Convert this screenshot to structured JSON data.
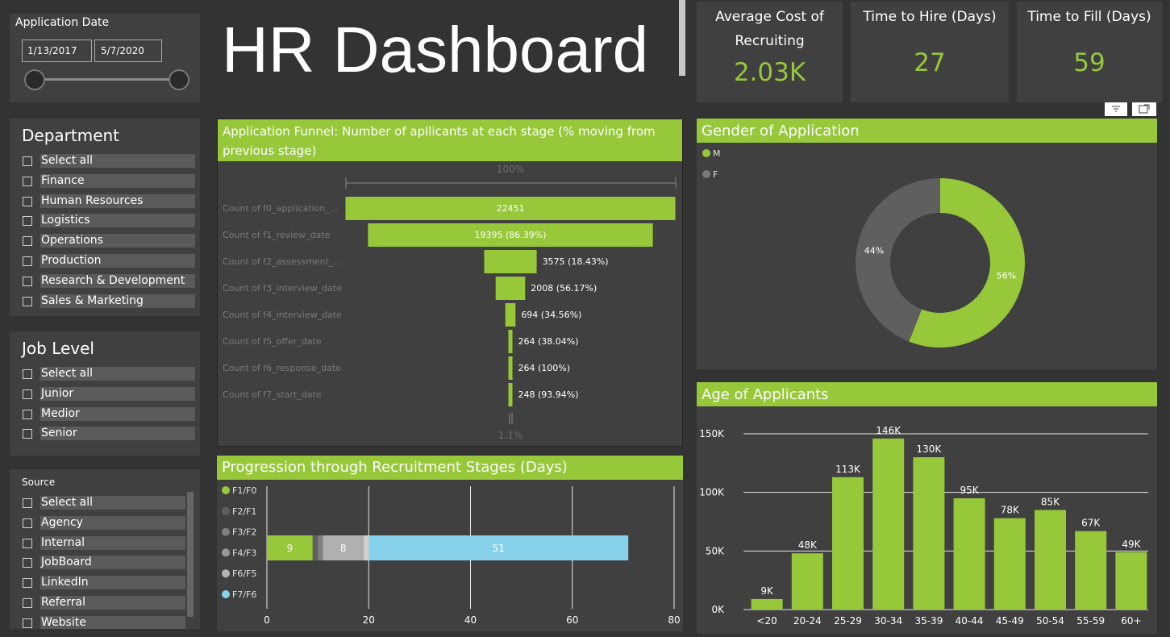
{
  "colors": {
    "accent": "#96c83a",
    "panel": "#404040",
    "bg": "#333333",
    "light_blue": "#87d1ea",
    "grey": "#7a7a7a",
    "light_grey": "#b4b4b4"
  },
  "title": "HR Dashboard",
  "date_slicer": {
    "label": "Application Date",
    "start": "1/13/2017",
    "end": "5/7/2020"
  },
  "department": {
    "title": "Department",
    "items": [
      "Select all",
      "Finance",
      "Human Resources",
      "Logistics",
      "Operations",
      "Production",
      "Research & Development",
      "Sales & Marketing"
    ]
  },
  "job_level": {
    "title": "Job Level",
    "items": [
      "Select all",
      "Junior",
      "Medior",
      "Senior"
    ]
  },
  "source": {
    "title": "Source",
    "items": [
      "Select all",
      "Agency",
      "Internal",
      "JobBoard",
      "LinkedIn",
      "Referral",
      "Website"
    ]
  },
  "kpis": [
    {
      "label": "Average Cost of Recruiting",
      "value": "2.03K"
    },
    {
      "label": "Time to Hire (Days)",
      "value": "27"
    },
    {
      "label": "Time to Fill (Days)",
      "value": "59"
    }
  ],
  "toolbar": {
    "filter_icon": "filter-icon",
    "focus_icon": "focus-mode-icon"
  },
  "funnel_title": "Application Funnel: Number of apllicants at each stage (% moving from previous stage)",
  "progression_title": "Progression through Recruitment Stages (Days)",
  "gender_title": "Gender of Application",
  "age_title": "Age of Applicants",
  "chart_data": [
    {
      "type": "bar",
      "subtype": "funnel",
      "top_label": "100%",
      "bottom_label": "1.1%",
      "categories": [
        "Count of f0_application_...",
        "Count of f1_review_date",
        "Count of f2_assessment_...",
        "Count of f3_interview_date",
        "Count of f4_interview_date",
        "Count of f5_offer_date",
        "Count of f6_response_date",
        "Count of f7_start_date"
      ],
      "values": [
        22451,
        19395,
        3575,
        2008,
        694,
        264,
        264,
        248
      ],
      "labels": [
        "22451",
        "19395 (86.39%)",
        "3575 (18.43%)",
        "2008 (56.17%)",
        "694 (34.56%)",
        "264 (38.04%)",
        "264 (100%)",
        "248 (93.94%)"
      ]
    },
    {
      "type": "bar",
      "subtype": "stacked-horizontal",
      "legend": [
        "F1/F0",
        "F2/F1",
        "F3/F2",
        "F4/F3",
        "F6/F5",
        "F7/F6"
      ],
      "legend_colors": [
        "#96c83a",
        "#606060",
        "#808080",
        "#9a9a9a",
        "#b4b4b4",
        "#87d1ea"
      ],
      "series": [
        {
          "name": "F1/F0",
          "value": 9,
          "label": "9",
          "color": "#96c83a"
        },
        {
          "name": "F2/F1",
          "value": 1,
          "label": "",
          "color": "#606060"
        },
        {
          "name": "F3/F2",
          "value": 1,
          "label": "",
          "color": "#808080"
        },
        {
          "name": "F4/F3",
          "value": 8,
          "label": "8",
          "color": "#b0b0b0"
        },
        {
          "name": "F6/F5",
          "value": 1,
          "label": "",
          "color": "#d0d0d0"
        },
        {
          "name": "F7/F6",
          "value": 51,
          "label": "51",
          "color": "#87d1ea"
        }
      ],
      "xlim": [
        0,
        80
      ],
      "xticks": [
        0,
        20,
        40,
        60,
        80
      ]
    },
    {
      "type": "pie",
      "subtype": "donut",
      "legend": "top-left",
      "slices": [
        {
          "name": "M",
          "value": 56,
          "label": "56%",
          "color": "#96c83a"
        },
        {
          "name": "F",
          "value": 44,
          "label": "44%",
          "color": "#5f5f5f"
        }
      ]
    },
    {
      "type": "bar",
      "categories": [
        "<20",
        "20-24",
        "25-29",
        "30-34",
        "35-39",
        "40-44",
        "45-49",
        "50-54",
        "55-59",
        "60+"
      ],
      "values": [
        9000,
        48000,
        113000,
        146000,
        130000,
        95000,
        78000,
        85000,
        67000,
        49000
      ],
      "labels": [
        "9K",
        "48K",
        "113K",
        "146K",
        "130K",
        "95K",
        "78K",
        "85K",
        "67K",
        "49K"
      ],
      "ylim": [
        0,
        150000
      ],
      "yticks": [
        0,
        50000,
        100000,
        150000
      ],
      "ytick_labels": [
        "0K",
        "50K",
        "100K",
        "150K"
      ],
      "grid": true
    }
  ]
}
